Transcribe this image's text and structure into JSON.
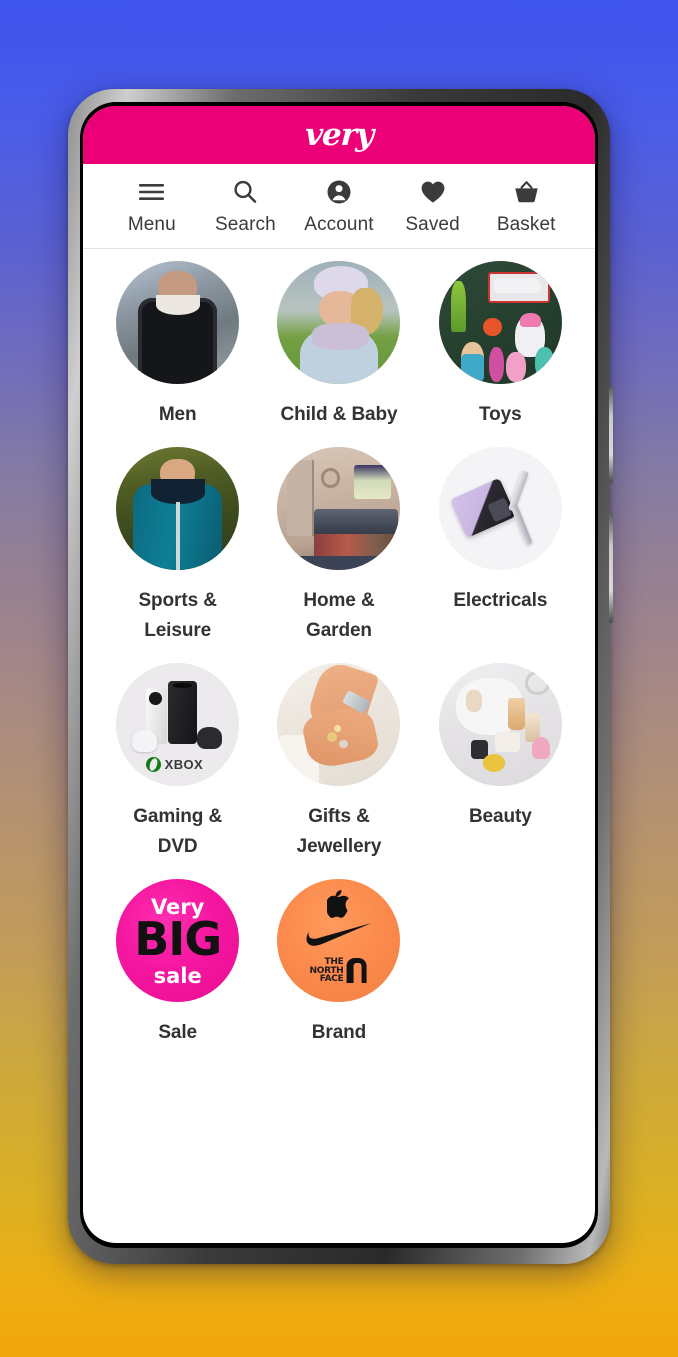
{
  "brandbar": {
    "logo_text": "very",
    "background_color": "#ec0078"
  },
  "nav": {
    "items": [
      {
        "label": "Menu",
        "icon": "hamburger-menu-icon"
      },
      {
        "label": "Search",
        "icon": "search-icon"
      },
      {
        "label": "Account",
        "icon": "account-person-icon"
      },
      {
        "label": "Saved",
        "icon": "heart-filled-icon"
      },
      {
        "label": "Basket",
        "icon": "basket-icon"
      }
    ]
  },
  "categories": [
    {
      "label": "Men",
      "thumb": "man-in-black-jacket-photo"
    },
    {
      "label": "Child & Baby",
      "thumb": "child-in-beanie-hat-photo"
    },
    {
      "label": "Toys",
      "thumb": "toy-shelf-photo"
    },
    {
      "label": "Sports & Leisure",
      "thumb": "man-in-teal-hoodie-photo"
    },
    {
      "label": "Home & Garden",
      "thumb": "bedroom-interior-photo"
    },
    {
      "label": "Electricals",
      "thumb": "folding-phones-photo"
    },
    {
      "label": "Gaming & DVD",
      "thumb": "xbox-consoles-photo"
    },
    {
      "label": "Gifts & Jewellery",
      "thumb": "hands-with-jewellery-photo"
    },
    {
      "label": "Beauty",
      "thumb": "beauty-products-flatlay-photo"
    },
    {
      "label": "Sale",
      "thumb": "very-big-sale-badge"
    },
    {
      "label": "Brand",
      "thumb": "brand-logos-badge"
    }
  ],
  "sale_badge": {
    "line1": "Very",
    "line2": "BIG",
    "line3": "sale",
    "background_color": "#f516a0"
  },
  "brand_badge": {
    "logos": [
      "apple-logo",
      "nike-swoosh-logo",
      "the-north-face-logo"
    ],
    "tnf_line1": "THE",
    "tnf_line2": "NORTH",
    "tnf_line3": "FACE",
    "background_color": "#fb8a4c"
  },
  "theme": {
    "accent": "#ec0078",
    "label_color": "#333333",
    "nav_color": "#3b3b3b",
    "screen_background": "#ffffff"
  }
}
